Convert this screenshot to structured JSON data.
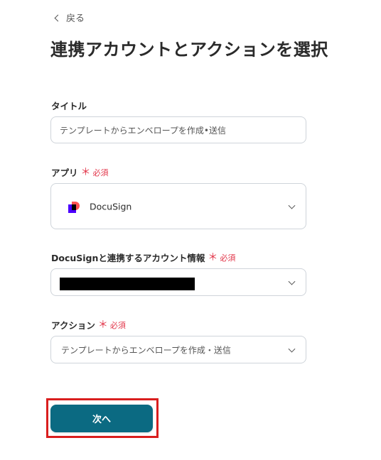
{
  "back": {
    "label": "戻る"
  },
  "page_title": "連携アカウントとアクションを選択",
  "required_label": "必須",
  "required_mark": "＊",
  "fields": {
    "title": {
      "label": "タイトル",
      "value": "テンプレートからエンベロープを作成•送信"
    },
    "app": {
      "label": "アプリ",
      "value": "DocuSign",
      "icon": "docusign-logo-icon",
      "brand_colors": [
        "#4c00ff",
        "#ff5252"
      ]
    },
    "account": {
      "label": "DocuSignと連携するアカウント情報",
      "value_redacted": true
    },
    "action": {
      "label": "アクション",
      "value": "テンプレートからエンベロープを作成・送信"
    }
  },
  "next_button": {
    "label": "次へ",
    "color": "#0b6a82",
    "highlight_color": "#d91e1e"
  }
}
